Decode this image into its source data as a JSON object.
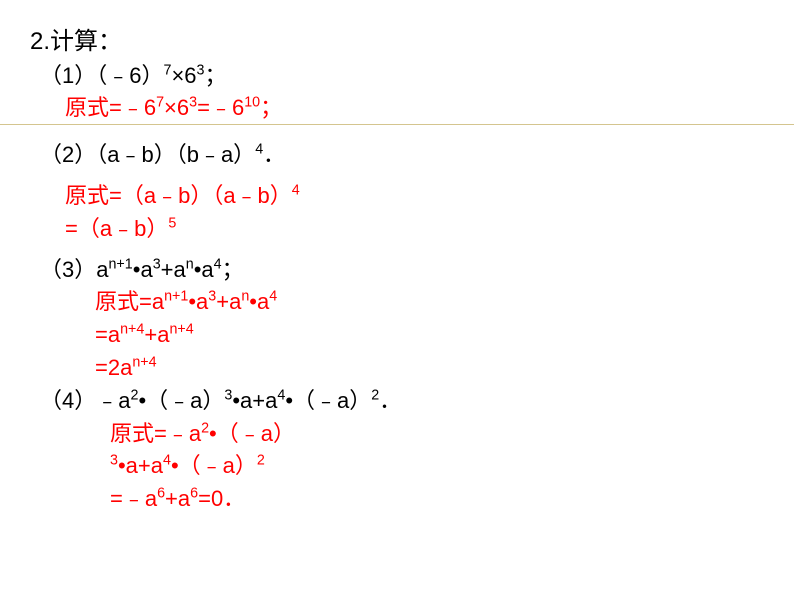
{
  "title": "2.计算：",
  "p1": {
    "question": "（1）（﹣6）",
    "exp1": "7",
    "mid1": "×6",
    "exp2": "3",
    "end1": "；",
    "answer_prefix": "原式=﹣6",
    "ans_exp1": "7",
    "ans_mid": "×6",
    "ans_exp2": "3",
    "ans_mid2": "=﹣6",
    "ans_exp3": "10",
    "ans_end": "；"
  },
  "p2": {
    "question": "（2）（a﹣b）（b﹣a）",
    "exp1": "4",
    "end": "．",
    "ans_line1_prefix": "原式=（a﹣b）（a﹣b）",
    "ans_line1_exp": "4",
    "ans_line2_prefix": "=（a﹣b）",
    "ans_line2_exp": "5"
  },
  "p3": {
    "question_prefix": "（3）a",
    "exp1": "n+1",
    "mid1": "•a",
    "exp2": "3",
    "mid2": "+a",
    "exp3": "n",
    "mid3": "•a",
    "exp4": "4",
    "end": "；",
    "ans_l1_prefix": "原式=a",
    "ans_l1_exp1": "n+1",
    "ans_l1_mid1": "•a",
    "ans_l1_exp2": "3",
    "ans_l1_mid2": "+a",
    "ans_l1_exp3": "n",
    "ans_l1_mid3": "•a",
    "ans_l1_exp4": "4",
    "ans_l2_prefix": "=a",
    "ans_l2_exp1": "n+4",
    "ans_l2_mid": "+a",
    "ans_l2_exp2": "n+4",
    "ans_l3_prefix": "=2a",
    "ans_l3_exp": "n+4"
  },
  "p4": {
    "q_prefix": "（4）﹣a",
    "q_exp1": "2",
    "q_mid1": "•（﹣a）",
    "q_exp2": "3",
    "q_mid2": "•a+a",
    "q_exp3": "4",
    "q_mid3": "•（﹣a）",
    "q_exp4": "2",
    "q_end": "．",
    "ans_l1_prefix": "原式=﹣a",
    "ans_l1_exp1": "2",
    "ans_l1_mid1": "•（﹣a）",
    "ans_l2_exp1": "3",
    "ans_l2_mid1": "•a+a",
    "ans_l2_exp2": "4",
    "ans_l2_mid2": "•（﹣a）",
    "ans_l2_exp3": "2",
    "ans_l3_prefix": "=﹣a",
    "ans_l3_exp1": "6",
    "ans_l3_mid": "+a",
    "ans_l3_exp2": "6",
    "ans_l3_end": "=0．"
  }
}
